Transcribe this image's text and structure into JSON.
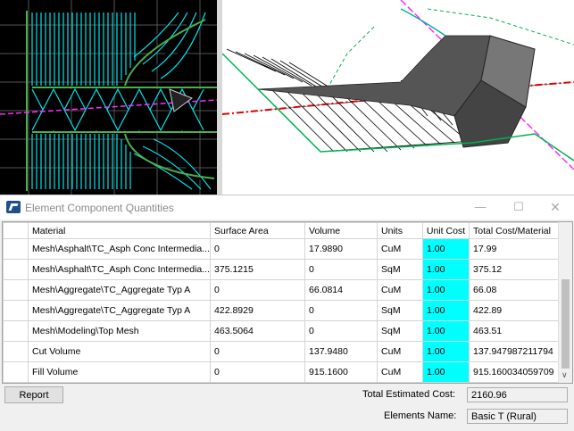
{
  "window": {
    "title": "Element Component Quantities"
  },
  "window_controls": {
    "minimize": "—",
    "maximize": "☐",
    "close": "✕"
  },
  "table": {
    "headers": [
      "Material",
      "Surface Area",
      "Volume",
      "Units",
      "Unit Cost",
      "Total Cost/Material"
    ],
    "rows": [
      [
        "Mesh\\Asphalt\\TC_Asph Conc Intermedia...",
        "0",
        "17.9890",
        "CuM",
        "1.00",
        "17.99"
      ],
      [
        "Mesh\\Asphalt\\TC_Asph Conc Intermedia...",
        "375.1215",
        "0",
        "SqM",
        "1.00",
        "375.12"
      ],
      [
        "Mesh\\Aggregate\\TC_Aggregate Typ A",
        "0",
        "66.0814",
        "CuM",
        "1.00",
        "66.08"
      ],
      [
        "Mesh\\Aggregate\\TC_Aggregate Typ A",
        "422.8929",
        "0",
        "SqM",
        "1.00",
        "422.89"
      ],
      [
        "Mesh\\Modeling\\Top Mesh",
        "463.5064",
        "0",
        "SqM",
        "1.00",
        "463.51"
      ],
      [
        "Cut Volume",
        "0",
        "137.9480",
        "CuM",
        "1.00",
        "137.947987211794"
      ],
      [
        "Fill Volume",
        "0",
        "915.1600",
        "CuM",
        "1.00",
        "915.160034059709"
      ]
    ]
  },
  "footer": {
    "report_label": "Report",
    "total_cost_label": "Total Estimated Cost:",
    "total_cost_value": "2160.96",
    "elements_name_label": "Elements Name:",
    "elements_name_value": "Basic T (Rural)"
  },
  "colors": {
    "unit_cost_cell": "#00ffff",
    "cad_background": "#000000",
    "mesh_lines": "#00ffff"
  }
}
